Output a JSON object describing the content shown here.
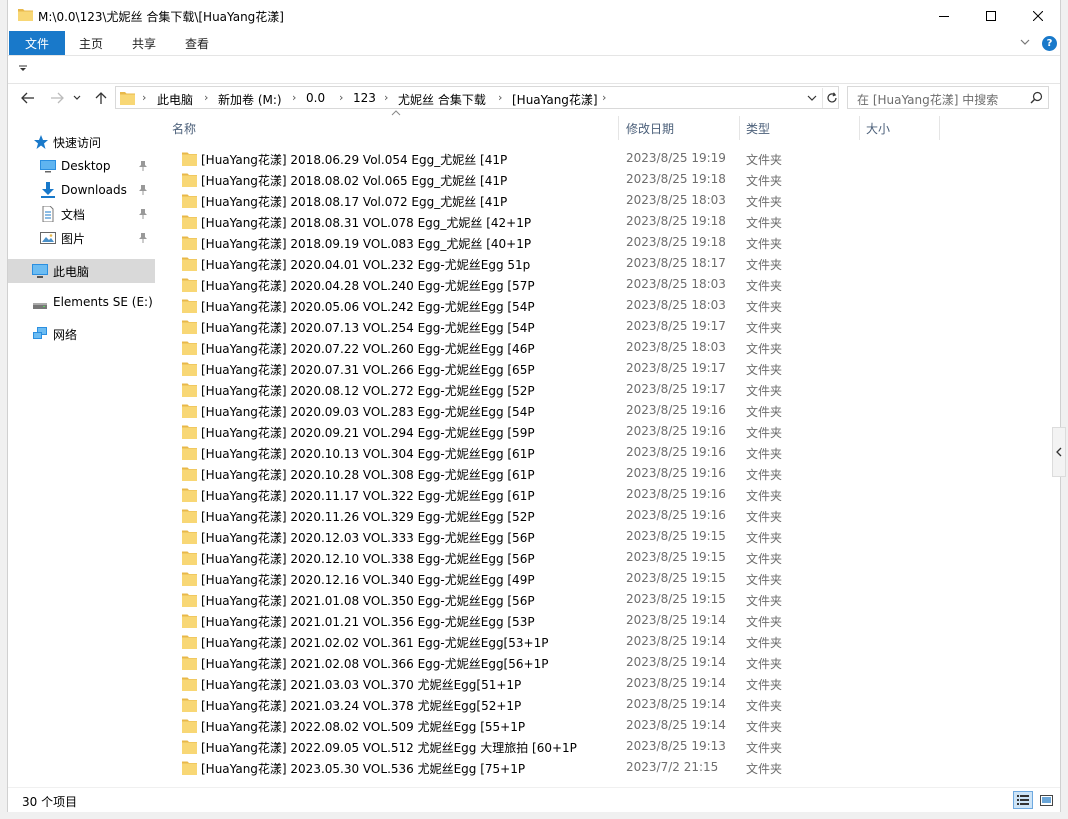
{
  "window": {
    "title": "M:\\0.0\\123\\尤妮丝 合集下载\\[HuaYang花漾]"
  },
  "ribbon": {
    "tabs": [
      "文件",
      "主页",
      "共享",
      "查看"
    ],
    "help": "?"
  },
  "address": {
    "crumbs": [
      "此电脑",
      "新加卷 (M:)",
      "0.0",
      "123",
      "尤妮丝 合集下载",
      "[HuaYang花漾]"
    ]
  },
  "search": {
    "placeholder": "在 [HuaYang花漾] 中搜索"
  },
  "navpane": {
    "items": [
      {
        "label": "快速访问",
        "icon": "star-icon"
      },
      {
        "label": "Desktop",
        "icon": "desktop-icon",
        "pinned": true
      },
      {
        "label": "Downloads",
        "icon": "download-icon",
        "pinned": true
      },
      {
        "label": "文档",
        "icon": "document-icon",
        "pinned": true
      },
      {
        "label": "图片",
        "icon": "pictures-icon",
        "pinned": true
      },
      {
        "label": "此电脑",
        "icon": "computer-icon",
        "selected": true
      },
      {
        "label": "Elements SE (E:)",
        "icon": "drive-icon"
      },
      {
        "label": "网络",
        "icon": "network-icon"
      }
    ]
  },
  "columns": {
    "name": "名称",
    "date": "修改日期",
    "type": "类型",
    "size": "大小"
  },
  "files": [
    {
      "name": "[HuaYang花漾] 2018.06.29 Vol.054 Egg_尤妮丝 [41P",
      "date": "2023/8/25 19:19",
      "type": "文件夹"
    },
    {
      "name": "[HuaYang花漾] 2018.08.02 Vol.065 Egg_尤妮丝 [41P",
      "date": "2023/8/25 19:18",
      "type": "文件夹"
    },
    {
      "name": "[HuaYang花漾] 2018.08.17 Vol.072 Egg_尤妮丝 [41P",
      "date": "2023/8/25 18:03",
      "type": "文件夹"
    },
    {
      "name": "[HuaYang花漾] 2018.08.31 VOL.078 Egg_尤妮丝 [42+1P",
      "date": "2023/8/25 19:18",
      "type": "文件夹"
    },
    {
      "name": "[HuaYang花漾] 2018.09.19 VOL.083 Egg_尤妮丝 [40+1P",
      "date": "2023/8/25 19:18",
      "type": "文件夹"
    },
    {
      "name": "[HuaYang花漾] 2020.04.01 VOL.232 Egg-尤妮丝Egg 51p",
      "date": "2023/8/25 18:17",
      "type": "文件夹"
    },
    {
      "name": "[HuaYang花漾] 2020.04.28 VOL.240 Egg-尤妮丝Egg [57P",
      "date": "2023/8/25 18:03",
      "type": "文件夹"
    },
    {
      "name": "[HuaYang花漾] 2020.05.06 VOL.242 Egg-尤妮丝Egg [54P",
      "date": "2023/8/25 18:03",
      "type": "文件夹"
    },
    {
      "name": "[HuaYang花漾] 2020.07.13 VOL.254 Egg-尤妮丝Egg [54P",
      "date": "2023/8/25 19:17",
      "type": "文件夹"
    },
    {
      "name": "[HuaYang花漾] 2020.07.22 VOL.260 Egg-尤妮丝Egg [46P",
      "date": "2023/8/25 18:03",
      "type": "文件夹"
    },
    {
      "name": "[HuaYang花漾] 2020.07.31 VOL.266 Egg-尤妮丝Egg [65P",
      "date": "2023/8/25 19:17",
      "type": "文件夹"
    },
    {
      "name": "[HuaYang花漾] 2020.08.12 VOL.272 Egg-尤妮丝Egg [52P",
      "date": "2023/8/25 19:17",
      "type": "文件夹"
    },
    {
      "name": "[HuaYang花漾] 2020.09.03 VOL.283 Egg-尤妮丝Egg [54P",
      "date": "2023/8/25 19:16",
      "type": "文件夹"
    },
    {
      "name": "[HuaYang花漾] 2020.09.21 VOL.294 Egg-尤妮丝Egg [59P",
      "date": "2023/8/25 19:16",
      "type": "文件夹"
    },
    {
      "name": "[HuaYang花漾] 2020.10.13 VOL.304 Egg-尤妮丝Egg [61P",
      "date": "2023/8/25 19:16",
      "type": "文件夹"
    },
    {
      "name": "[HuaYang花漾] 2020.10.28 VOL.308 Egg-尤妮丝Egg [61P",
      "date": "2023/8/25 19:16",
      "type": "文件夹"
    },
    {
      "name": "[HuaYang花漾] 2020.11.17 VOL.322 Egg-尤妮丝Egg [61P",
      "date": "2023/8/25 19:16",
      "type": "文件夹"
    },
    {
      "name": "[HuaYang花漾] 2020.11.26 VOL.329 Egg-尤妮丝Egg [52P",
      "date": "2023/8/25 19:16",
      "type": "文件夹"
    },
    {
      "name": "[HuaYang花漾] 2020.12.03 VOL.333 Egg-尤妮丝Egg [56P",
      "date": "2023/8/25 19:15",
      "type": "文件夹"
    },
    {
      "name": "[HuaYang花漾] 2020.12.10 VOL.338 Egg-尤妮丝Egg [56P",
      "date": "2023/8/25 19:15",
      "type": "文件夹"
    },
    {
      "name": "[HuaYang花漾] 2020.12.16 VOL.340 Egg-尤妮丝Egg [49P",
      "date": "2023/8/25 19:15",
      "type": "文件夹"
    },
    {
      "name": "[HuaYang花漾] 2021.01.08 VOL.350 Egg-尤妮丝Egg [56P",
      "date": "2023/8/25 19:15",
      "type": "文件夹"
    },
    {
      "name": "[HuaYang花漾] 2021.01.21 VOL.356 Egg-尤妮丝Egg [53P",
      "date": "2023/8/25 19:14",
      "type": "文件夹"
    },
    {
      "name": "[HuaYang花漾] 2021.02.02 VOL.361 Egg-尤妮丝Egg[53+1P",
      "date": "2023/8/25 19:14",
      "type": "文件夹"
    },
    {
      "name": "[HuaYang花漾] 2021.02.08 VOL.366 Egg-尤妮丝Egg[56+1P",
      "date": "2023/8/25 19:14",
      "type": "文件夹"
    },
    {
      "name": "[HuaYang花漾] 2021.03.03 VOL.370 尤妮丝Egg[51+1P",
      "date": "2023/8/25 19:14",
      "type": "文件夹"
    },
    {
      "name": "[HuaYang花漾] 2021.03.24 VOL.378 尤妮丝Egg[52+1P",
      "date": "2023/8/25 19:14",
      "type": "文件夹"
    },
    {
      "name": "[HuaYang花漾] 2022.08.02 VOL.509 尤妮丝Egg [55+1P",
      "date": "2023/8/25 19:14",
      "type": "文件夹"
    },
    {
      "name": "[HuaYang花漾] 2022.09.05 VOL.512 尤妮丝Egg 大理旅拍 [60+1P",
      "date": "2023/8/25 19:13",
      "type": "文件夹"
    },
    {
      "name": "[HuaYang花漾] 2023.05.30 VOL.536 尤妮丝Egg [75+1P",
      "date": "2023/7/2 21:15",
      "type": "文件夹"
    }
  ],
  "status": {
    "count": "30 个项目"
  },
  "colors": {
    "accent": "#1979ca",
    "folder": "#f8d775",
    "folder_dark": "#e8b84a",
    "selected_nav": "#d9d9d9"
  }
}
